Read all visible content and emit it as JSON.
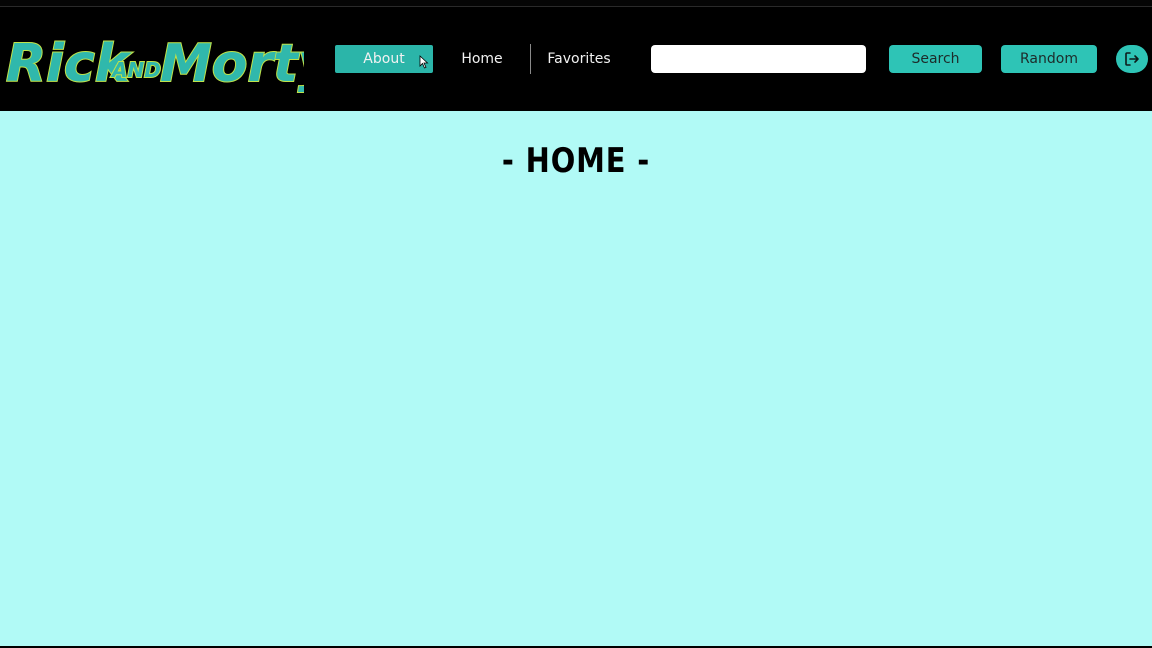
{
  "brand": {
    "logo_text": "Rick and Morty"
  },
  "nav": {
    "about_label": "About",
    "home_label": "Home",
    "favorites_label": "Favorites"
  },
  "search": {
    "value": "",
    "placeholder": ""
  },
  "buttons": {
    "search_label": "Search",
    "random_label": "Random",
    "logout_icon": "logout-icon"
  },
  "main": {
    "title": "- HOME -"
  },
  "colors": {
    "navbar_bg": "#000000",
    "accent": "#2ec4b6",
    "active_nav": "#2bb5a9",
    "page_bg": "#b1faf6",
    "logo_fill": "#30b8ac",
    "logo_outline": "#bfe34a"
  }
}
